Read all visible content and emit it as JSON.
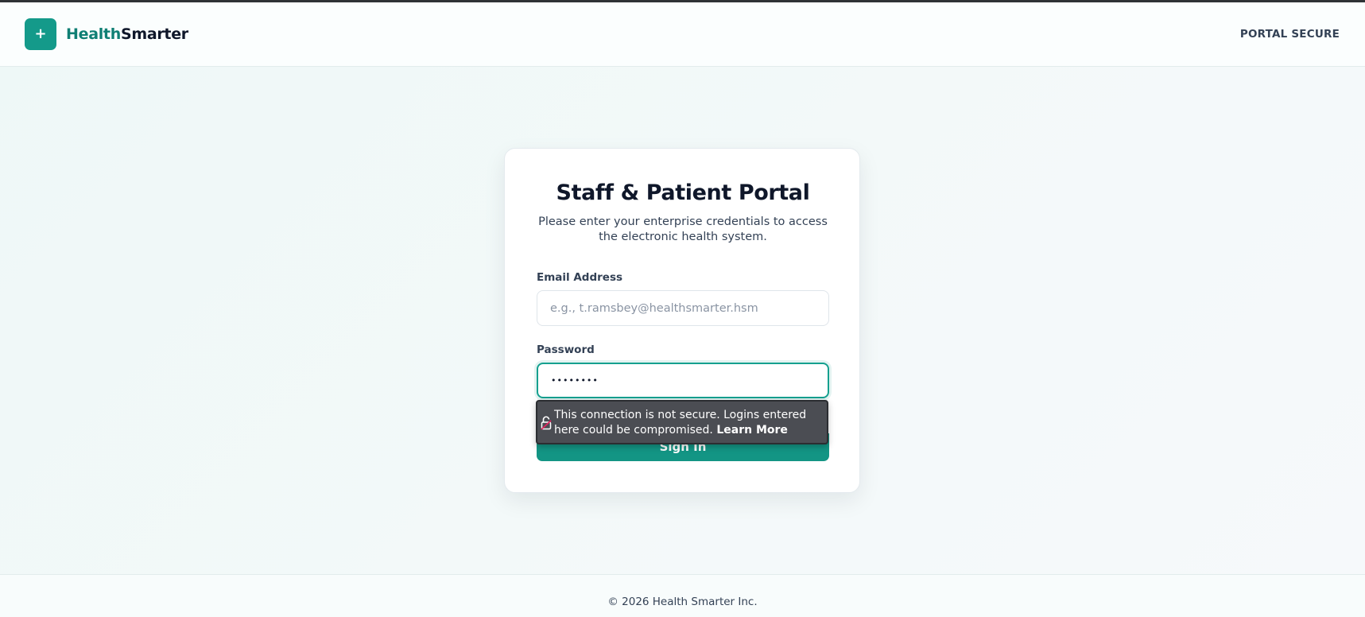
{
  "header": {
    "brand_part1": "Health",
    "brand_part2": "Smarter",
    "logo_glyph": "+",
    "status_label": "PORTAL SECURE"
  },
  "card": {
    "title": "Staff & Patient Portal",
    "subtitle": "Please enter your enterprise credentials to access the electronic health system.",
    "email_label": "Email Address",
    "email_value": "",
    "email_placeholder": "e.g., t.ramsbey@healthsmarter.hsm",
    "password_label": "Password",
    "password_value": "••••••••",
    "sign_in_label": "Sign In"
  },
  "popup": {
    "message": "This connection is not secure. Logins entered here could be compromised. ",
    "link_label": "Learn More",
    "icon": "broken-lock-icon"
  },
  "footer": {
    "copyright": "© 2026 Health Smarter Inc."
  },
  "colors": {
    "brand_teal": "#149a8a",
    "button_teal": "#139584",
    "popup_bg": "#4b4d53",
    "lock_red": "#e0245e"
  }
}
